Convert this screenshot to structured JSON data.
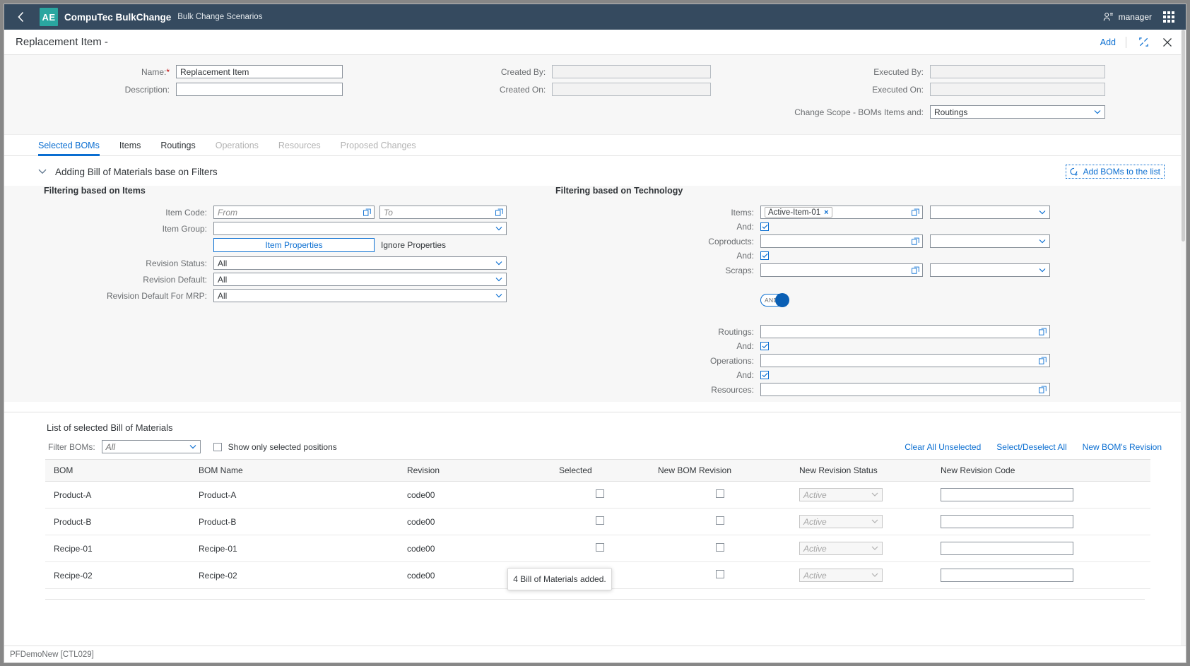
{
  "shell": {
    "back_icon": "chevron-left-icon",
    "logo_text": "AE",
    "app_title": "CompuTec BulkChange",
    "app_subtitle": "Bulk Change Scenarios",
    "user_name": "manager",
    "user_icon": "user-settings-icon",
    "grid_icon": "app-grid-icon",
    "bg_color": "#354a5f",
    "logo_color": "#2aa6a0"
  },
  "page_header": {
    "title": "Replacement Item -",
    "add_label": "Add",
    "expand_icon": "full-screen-icon",
    "close_icon": "close-icon"
  },
  "form": {
    "name_label": "Name:",
    "name_required": "*",
    "name_value": "Replacement Item",
    "description_label": "Description:",
    "description_value": "",
    "created_by_label": "Created By:",
    "created_by_value": "",
    "created_on_label": "Created On:",
    "created_on_value": "",
    "executed_by_label": "Executed By:",
    "executed_by_value": "",
    "executed_on_label": "Executed On:",
    "executed_on_value": "",
    "change_scope_label": "Change Scope - BOMs Items and:",
    "change_scope_value": "Routings"
  },
  "tabs": [
    {
      "label": "Selected BOMs",
      "state": "active"
    },
    {
      "label": "Items",
      "state": "enabled"
    },
    {
      "label": "Routings",
      "state": "enabled"
    },
    {
      "label": "Operations",
      "state": "disabled"
    },
    {
      "label": "Resources",
      "state": "disabled"
    },
    {
      "label": "Proposed Changes",
      "state": "disabled"
    }
  ],
  "section": {
    "collapse_icon": "chevron-down-icon",
    "title": "Adding Bill of Materials base on Filters",
    "add_boms_label": "Add BOMs to the list",
    "add_boms_icon": "add-boms-icon"
  },
  "filter_items": {
    "heading": "Filtering based on Items",
    "item_code_label": "Item Code:",
    "item_code_from_placeholder": "From",
    "item_code_from_value": "",
    "item_code_to_placeholder": "To",
    "item_code_to_value": "",
    "item_group_label": "Item Group:",
    "item_group_value": "",
    "item_properties_btn": "Item Properties",
    "ignore_properties_label": "Ignore Properties",
    "revision_status_label": "Revision Status:",
    "revision_status_value": "All",
    "revision_default_label": "Revision Default:",
    "revision_default_value": "All",
    "revision_default_mrp_label": "Revision Default For MRP:",
    "revision_default_mrp_value": "All"
  },
  "filter_tech": {
    "heading": "Filtering based on Technology",
    "items_label": "Items:",
    "items_token": "Active-Item-01",
    "items_token_remove": "×",
    "items_right_value": "",
    "and1_label": "And:",
    "and1_checked": true,
    "coproducts_label": "Coproducts:",
    "coproducts_value": "",
    "coproducts_right_value": "",
    "and2_label": "And:",
    "and2_checked": true,
    "scraps_label": "Scraps:",
    "scraps_value": "",
    "scraps_right_value": "",
    "and_toggle_label": "AND",
    "and_toggle_on": true,
    "routings_label": "Routings:",
    "routings_value": "",
    "and3_label": "And:",
    "and3_checked": true,
    "operations_label": "Operations:",
    "operations_value": "",
    "and4_label": "And:",
    "and4_checked": true,
    "resources_label": "Resources:",
    "resources_value": ""
  },
  "list": {
    "title": "List of selected Bill of Materials",
    "filter_boms_label": "Filter BOMs:",
    "filter_boms_value": "All",
    "show_only_selected_label": "Show only selected positions",
    "show_only_selected_checked": false,
    "links": [
      "Clear All Unselected",
      "Select/Deselect All",
      "New BOM's Revision"
    ],
    "columns": [
      "BOM",
      "BOM Name",
      "Revision",
      "Selected",
      "New BOM Revision",
      "New Revision Status",
      "New Revision Code"
    ],
    "rows": [
      {
        "bom": "Product-A",
        "bom_name": "Product-A",
        "revision": "code00",
        "selected": false,
        "new_bom_revision": false,
        "new_revision_status": "Active",
        "new_revision_code": ""
      },
      {
        "bom": "Product-B",
        "bom_name": "Product-B",
        "revision": "code00",
        "selected": false,
        "new_bom_revision": false,
        "new_revision_status": "Active",
        "new_revision_code": ""
      },
      {
        "bom": "Recipe-01",
        "bom_name": "Recipe-01",
        "revision": "code00",
        "selected": false,
        "new_bom_revision": false,
        "new_revision_status": "Active",
        "new_revision_code": ""
      },
      {
        "bom": "Recipe-02",
        "bom_name": "Recipe-02",
        "revision": "code00",
        "selected": false,
        "new_bom_revision": false,
        "new_revision_status": "Active",
        "new_revision_code": ""
      }
    ]
  },
  "toast": {
    "message": "4 Bill of Materials added."
  },
  "status_bar": {
    "text": "PFDemoNew [CTL029]"
  },
  "colors": {
    "accent": "#0a6ed1",
    "header_bg": "#354a5f",
    "logo_bg": "#2aa6a0",
    "required": "#bb0000"
  }
}
